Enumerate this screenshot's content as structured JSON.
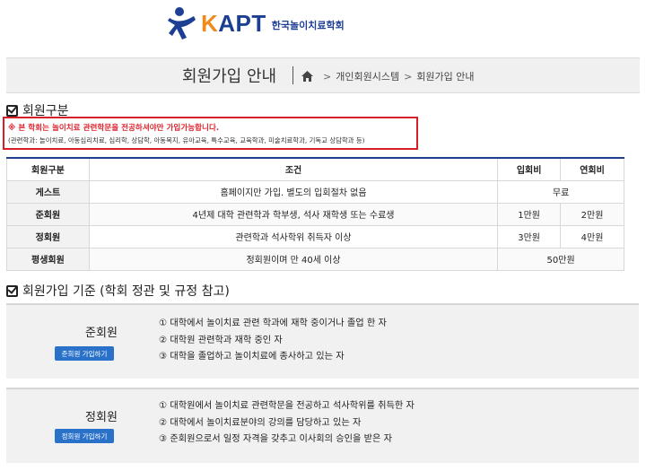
{
  "brand": {
    "name_accent": "K",
    "name_rest": "APT",
    "subtitle": "한국놀이치료학회"
  },
  "colors": {
    "brand_blue": "#1c3f94",
    "brand_orange": "#f08a1c",
    "notice_red": "#e0262f",
    "button_blue": "#2a72c9"
  },
  "header": {
    "title": "회원가입 안내",
    "breadcrumb": [
      "개인회원시스템",
      "회원가입 안내"
    ],
    "home_icon": "home-icon"
  },
  "section1": {
    "heading": "회원구분",
    "notice_main": "※ 본 학회는 놀이치료 관련학문을 전공하셔야만 가입가능합니다.",
    "notice_sub": "(관련학과: 놀이치료, 아동심리치료, 심리학, 상담학, 아동복지, 유아교육, 특수교육, 교육학과, 미술치료학과, 기독교 상담학과 등)"
  },
  "table": {
    "headers": [
      "회원구분",
      "조건",
      "입회비",
      "연회비"
    ],
    "rows": [
      {
        "type": "게스트",
        "condition": "홈페이지만 가입. 별도의 입회절차 없음",
        "fee": "무료"
      },
      {
        "type": "준회원",
        "condition": "4년제 대학 관련학과 학부생, 석사 재학생 또는 수료생",
        "entry": "1만원",
        "annual": "2만원"
      },
      {
        "type": "정회원",
        "condition": "관련학과 석사학위 취득자 이상",
        "entry": "3만원",
        "annual": "4만원"
      },
      {
        "type": "평생회원",
        "condition": "정회원이며 만 40세 이상",
        "fee": "50만원"
      }
    ]
  },
  "section2": {
    "heading": "회원가입 기준 (학회 정관 및 규정 참고)",
    "associate": {
      "name": "준회원",
      "button": "준회원 가입하기",
      "items": [
        "① 대학에서 놀이치료 관련 학과에 재학 중이거나 졸업 한 자",
        "② 대학원 관련학과 재학 중인 자",
        "③ 대학을 졸업하고 놀이치료에 종사하고 있는 자"
      ]
    },
    "regular": {
      "name": "정회원",
      "button": "정회원 가입하기",
      "items": [
        "① 대학원에서 놀이치료 관련학문을 전공하고 석사학위를 취득한 자",
        "② 대학에서 놀이치료분야의 강의를 담당하고 있는 자",
        "③ 준회원으로서 일정 자격을 갖추고 이사회의 승인을 받은 자"
      ]
    }
  }
}
